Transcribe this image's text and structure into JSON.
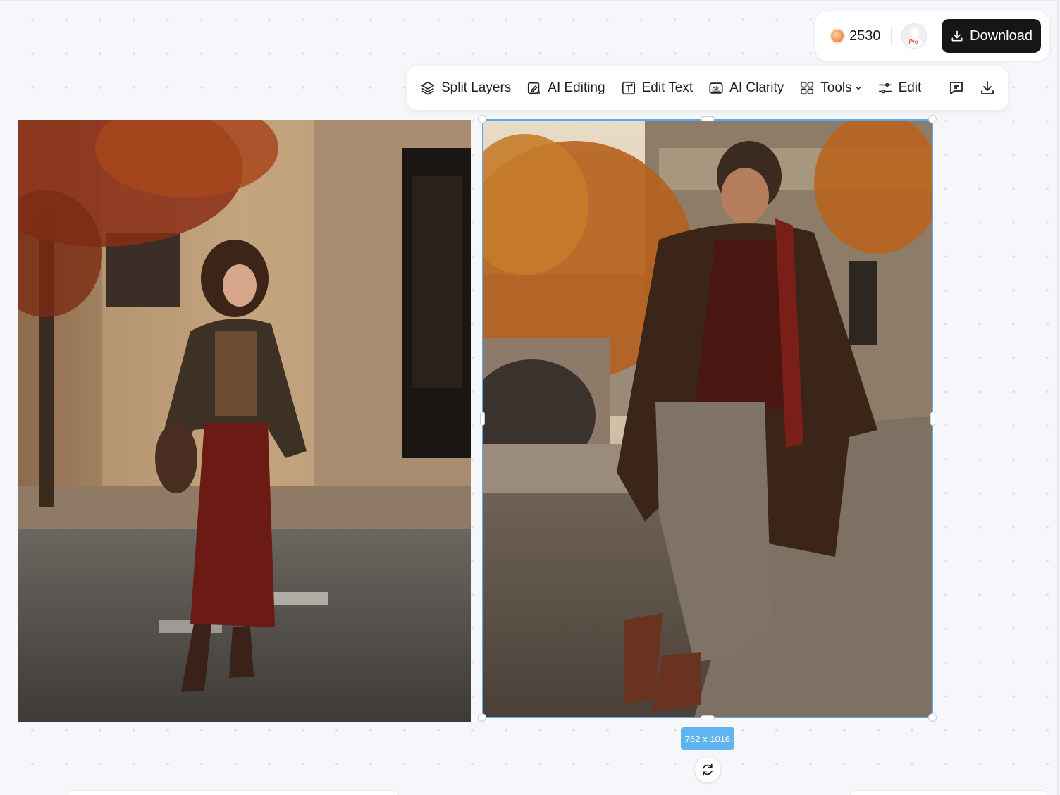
{
  "account": {
    "credits": "2530",
    "avatar_badge": "Pro",
    "download_label": "Download"
  },
  "toolbar": {
    "split_layers": "Split Layers",
    "ai_editing": "AI Editing",
    "edit_text": "Edit Text",
    "ai_clarity": "AI Clarity",
    "tools": "Tools",
    "edit": "Edit"
  },
  "canvas": {
    "selected_dimensions": "762 x 1016"
  },
  "icons": {
    "layers": "layers-icon",
    "ai_edit": "ai-edit-icon",
    "text": "text-icon",
    "hd": "hd-icon",
    "grid": "grid-icon",
    "sliders": "sliders-icon",
    "comment": "comment-icon",
    "download": "download-icon",
    "rotate": "rotate-icon"
  },
  "colors": {
    "selection": "#5aa9f0",
    "badge": "#5fb5ef",
    "download_button": "#161616"
  }
}
